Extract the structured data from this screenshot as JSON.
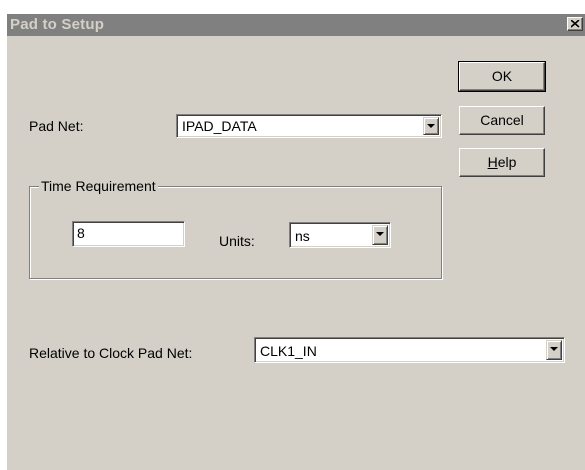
{
  "window": {
    "title": "Pad to Setup",
    "close_label": "×"
  },
  "pad_net": {
    "label": "Pad Net:",
    "value": "IPAD_DATA"
  },
  "time_requirement": {
    "group_label": "Time Requirement",
    "value": "8",
    "units_label": "Units:",
    "units_value": "ns"
  },
  "relative_clock": {
    "label": "Relative to Clock Pad Net:",
    "value": "CLK1_IN"
  },
  "buttons": {
    "ok": "OK",
    "cancel": "Cancel",
    "help_mnemonic": "H",
    "help_rest": "elp"
  },
  "icons": {
    "close": "close-icon",
    "dropdown": "chevron-down-icon"
  },
  "colors": {
    "dialog_face": "#d4d0c8",
    "titlebar_inactive": "#808080",
    "field_background": "#ffffff"
  }
}
